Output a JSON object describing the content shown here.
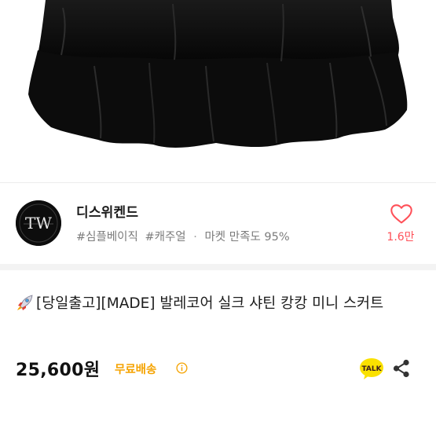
{
  "colors": {
    "accent_pink": "#ff5058",
    "shipping_orange": "#f5a300",
    "talk_yellow": "#fae100"
  },
  "product_image": {
    "alt": "product-photo-black-tiered-skirt"
  },
  "shop": {
    "logo_text": "TW",
    "name": "디스위켄드",
    "tag1": "#심플베이직",
    "tag2": "#캐주얼",
    "separator": "·",
    "satisfaction": "마켓 만족도 95%",
    "like_count": "1.6만"
  },
  "product": {
    "title": "[당일출고][MADE] 발레코어 실크 샤틴 캉캉 미니 스커트",
    "price": "25,600원",
    "shipping": "무료배송",
    "talk_label": "TALK"
  },
  "icons": {
    "rocket": "rocket-icon",
    "heart": "heart-outline-icon",
    "info": "info-icon",
    "talk": "kakaotalk-icon",
    "share": "share-icon"
  }
}
